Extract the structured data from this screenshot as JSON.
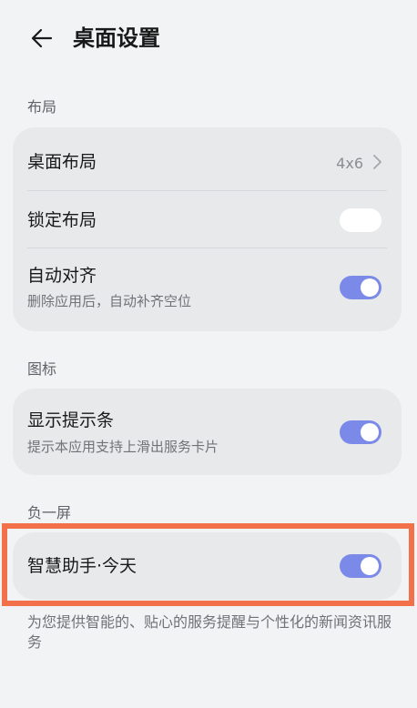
{
  "header": {
    "back_icon": "arrow-left-icon",
    "title": "桌面设置"
  },
  "sections": {
    "layout": {
      "label": "布局",
      "desktop_layout": {
        "title": "桌面布局",
        "value": "4x6",
        "icon": "chevron-right-icon"
      },
      "lock_layout": {
        "title": "锁定布局",
        "toggle": "off"
      },
      "auto_align": {
        "title": "自动对齐",
        "subtitle": "删除应用后，自动补齐空位",
        "toggle": "on"
      }
    },
    "icons": {
      "label": "图标",
      "show_hint_bar": {
        "title": "显示提示条",
        "subtitle": "提示本应用支持上滑出服务卡片",
        "toggle": "on"
      }
    },
    "negative_one_screen": {
      "label": "负一屏",
      "smart_assistant": {
        "title": "智慧助手·今天",
        "toggle": "on"
      },
      "description": "为您提供智能的、贴心的服务提醒与个性化的新闻资讯服务"
    }
  },
  "colors": {
    "accent": "#7b8ae8",
    "highlight": "#f2704a",
    "background": "#f1f3f5",
    "card": "#e8e9eb"
  }
}
